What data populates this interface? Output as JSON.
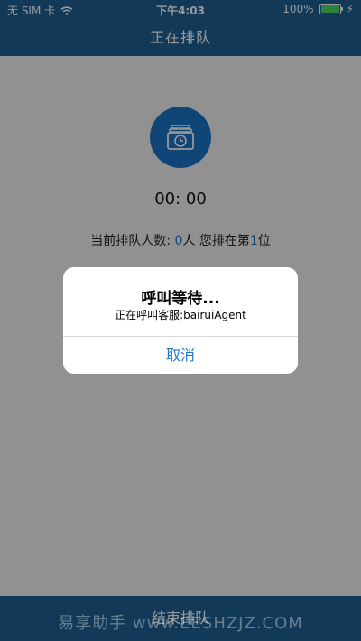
{
  "status_bar": {
    "carrier": "无 SIM 卡",
    "time": "下午4:03",
    "battery": "100%",
    "battery_level": 1.0,
    "icons": [
      "wifi-icon",
      "battery-icon",
      "charging-icon"
    ]
  },
  "nav": {
    "title": "正在排队"
  },
  "main": {
    "icon": "queue-clock-icon",
    "timer": "00: 00",
    "queue_prefix": "当前排队人数: ",
    "queue_count": "0",
    "queue_middle": "人 您排在第",
    "queue_position": "1",
    "queue_suffix": "位"
  },
  "bottom": {
    "end_label": "结束排队"
  },
  "alert": {
    "title": "呼叫等待...",
    "message": "正在呼叫客服:bairuiAgent",
    "cancel_label": "取消"
  },
  "watermark": {
    "text": "易享助手 www.EESHZJZ.COM"
  },
  "colors": {
    "primary": "#1f5f93",
    "accent": "#1b73c6",
    "link": "#1a76d2"
  }
}
